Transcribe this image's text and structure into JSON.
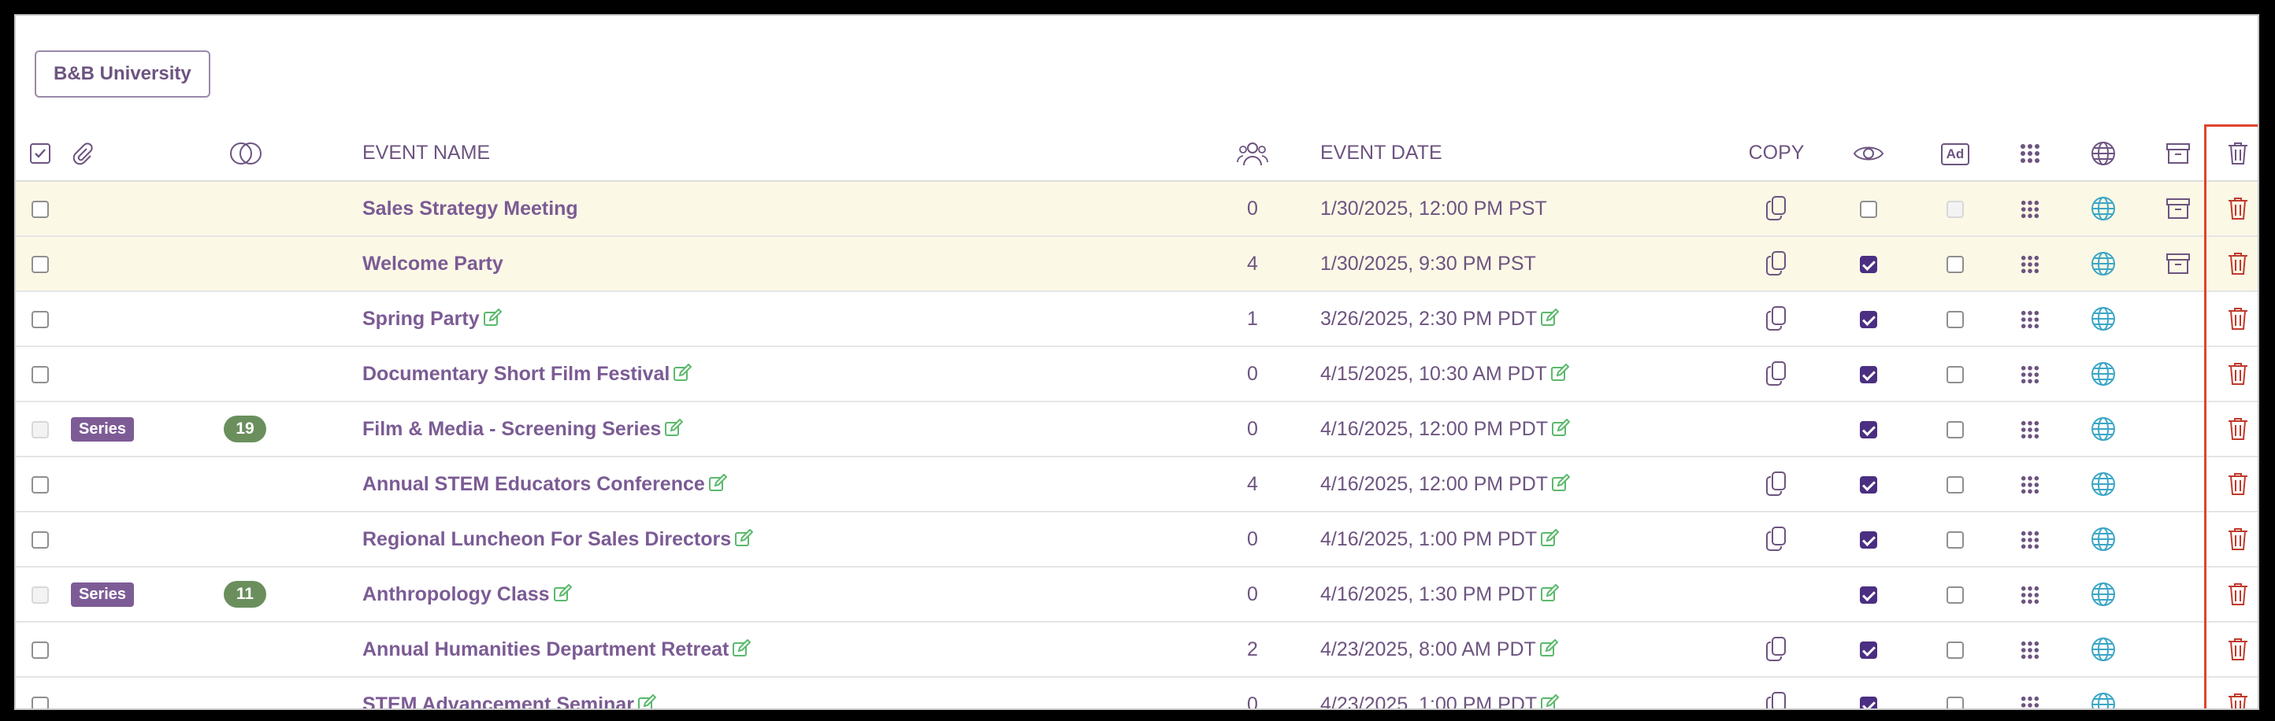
{
  "org_button": "B&B University",
  "headers": {
    "event_name": "EVENT NAME",
    "event_date": "EVENT DATE",
    "copy": "COPY",
    "ad_badge": "Ad"
  },
  "colors": {
    "text_purple": "#6d5480",
    "highlight_row": "#fcf8e6",
    "series_badge": "#7d5c96",
    "count_badge": "#6a8f5d",
    "edit_icon": "#5bb96c",
    "globe_icon": "#3ba6c6",
    "trash_icon": "#c0392b",
    "highlight_box": "#e0442b"
  },
  "rows": [
    {
      "name": "Sales Strategy Meeting",
      "series": "",
      "count": "",
      "attendees": "0",
      "date": "1/30/2025, 12:00 PM PST",
      "editable": false,
      "copy": true,
      "visible": false,
      "ad": false,
      "ad_disabled": true,
      "archive": true,
      "highlight": true,
      "checkbox_disabled": false
    },
    {
      "name": "Welcome Party",
      "series": "",
      "count": "",
      "attendees": "4",
      "date": "1/30/2025, 9:30 PM PST",
      "editable": false,
      "copy": true,
      "visible": true,
      "ad": false,
      "ad_disabled": false,
      "archive": true,
      "highlight": true,
      "checkbox_disabled": false
    },
    {
      "name": "Spring Party",
      "series": "",
      "count": "",
      "attendees": "1",
      "date": "3/26/2025, 2:30 PM PDT",
      "editable": true,
      "copy": true,
      "visible": true,
      "ad": false,
      "ad_disabled": false,
      "archive": false,
      "highlight": false,
      "checkbox_disabled": false
    },
    {
      "name": "Documentary Short Film Festival",
      "series": "",
      "count": "",
      "attendees": "0",
      "date": "4/15/2025, 10:30 AM PDT",
      "editable": true,
      "copy": true,
      "visible": true,
      "ad": false,
      "ad_disabled": false,
      "archive": false,
      "highlight": false,
      "checkbox_disabled": false
    },
    {
      "name": "Film & Media - Screening Series",
      "series": "Series",
      "count": "19",
      "attendees": "0",
      "date": "4/16/2025, 12:00 PM PDT",
      "editable": true,
      "copy": false,
      "visible": true,
      "ad": false,
      "ad_disabled": false,
      "archive": false,
      "highlight": false,
      "checkbox_disabled": true
    },
    {
      "name": "Annual STEM Educators Conference",
      "series": "",
      "count": "",
      "attendees": "4",
      "date": "4/16/2025, 12:00 PM PDT",
      "editable": true,
      "copy": true,
      "visible": true,
      "ad": false,
      "ad_disabled": false,
      "archive": false,
      "highlight": false,
      "checkbox_disabled": false
    },
    {
      "name": "Regional Luncheon For Sales Directors",
      "series": "",
      "count": "",
      "attendees": "0",
      "date": "4/16/2025, 1:00 PM PDT",
      "editable": true,
      "copy": true,
      "visible": true,
      "ad": false,
      "ad_disabled": false,
      "archive": false,
      "highlight": false,
      "checkbox_disabled": false
    },
    {
      "name": "Anthropology Class",
      "series": "Series",
      "count": "11",
      "attendees": "0",
      "date": "4/16/2025, 1:30 PM PDT",
      "editable": true,
      "copy": false,
      "visible": true,
      "ad": false,
      "ad_disabled": false,
      "archive": false,
      "highlight": false,
      "checkbox_disabled": true
    },
    {
      "name": "Annual Humanities Department Retreat",
      "series": "",
      "count": "",
      "attendees": "2",
      "date": "4/23/2025, 8:00 AM PDT",
      "editable": true,
      "copy": true,
      "visible": true,
      "ad": false,
      "ad_disabled": false,
      "archive": false,
      "highlight": false,
      "checkbox_disabled": false
    },
    {
      "name": "STEM Advancement Seminar",
      "series": "",
      "count": "",
      "attendees": "0",
      "date": "4/23/2025, 1:00 PM PDT",
      "editable": true,
      "copy": true,
      "visible": true,
      "ad": false,
      "ad_disabled": false,
      "archive": false,
      "highlight": false,
      "checkbox_disabled": false
    }
  ]
}
